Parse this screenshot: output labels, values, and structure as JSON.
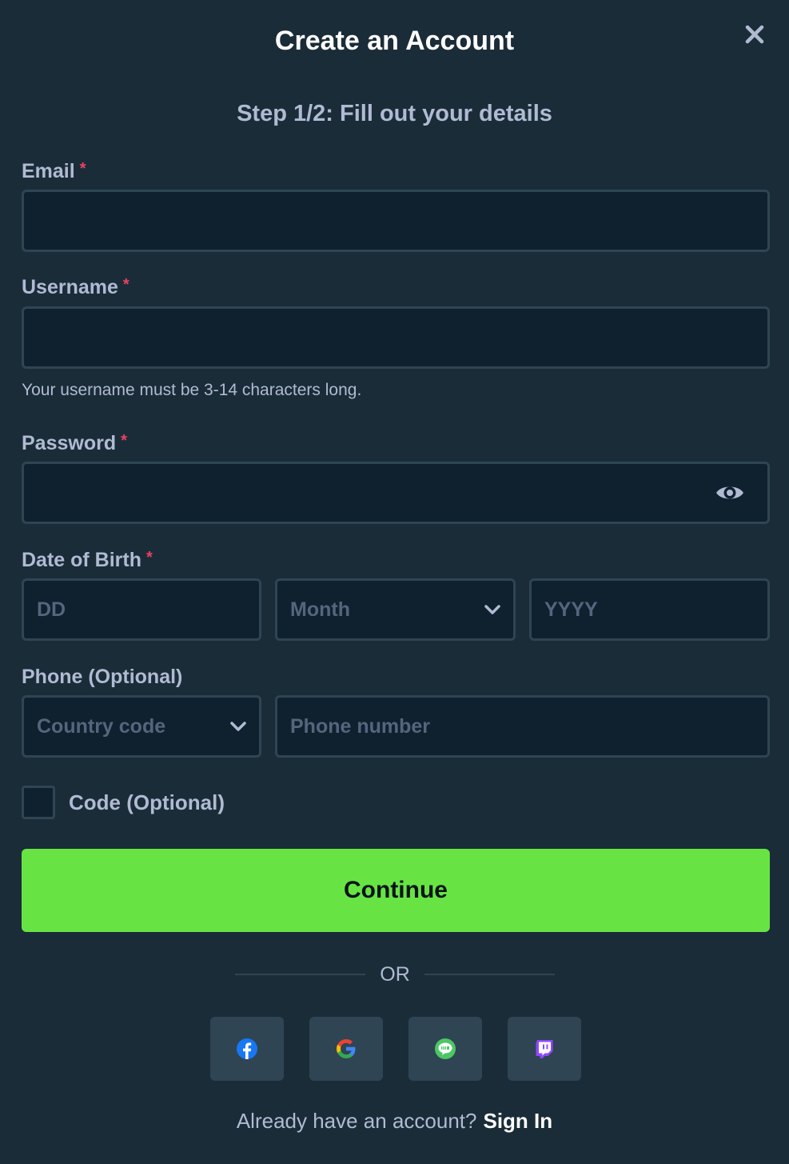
{
  "header": {
    "title": "Create an Account",
    "step": "Step 1/2: Fill out your details"
  },
  "form": {
    "required_mark": "*",
    "email": {
      "label": "Email",
      "value": "",
      "placeholder": ""
    },
    "username": {
      "label": "Username",
      "value": "",
      "placeholder": "",
      "hint": "Your username must be 3-14 characters long."
    },
    "password": {
      "label": "Password",
      "value": "",
      "placeholder": ""
    },
    "dob": {
      "label": "Date of Birth",
      "day_placeholder": "DD",
      "month_selected": "Month",
      "year_placeholder": "YYYY"
    },
    "phone": {
      "label": "Phone (Optional)",
      "country_selected": "Country code",
      "number_placeholder": "Phone number"
    },
    "code": {
      "label": "Code (Optional)",
      "checked": false
    }
  },
  "actions": {
    "continue_label": "Continue",
    "or_text": "OR",
    "signin_prefix": "Already have an account?",
    "signin_link": "Sign In"
  },
  "social": [
    {
      "name": "facebook-icon",
      "color": "#1877f2"
    },
    {
      "name": "google-icon",
      "color": "#4285f4"
    },
    {
      "name": "line-icon",
      "color": "#4cc764"
    },
    {
      "name": "twitch-icon",
      "color": "#9146ff"
    }
  ],
  "icons": {
    "close": "close-icon",
    "eye": "eye-icon",
    "chevron": "chevron-down-icon"
  },
  "colors": {
    "background": "#1a2c38",
    "input_background": "#0f212e",
    "border": "#2f4553",
    "accent": "#67e443",
    "required": "#ed4163",
    "muted_text": "#b1bad3"
  }
}
